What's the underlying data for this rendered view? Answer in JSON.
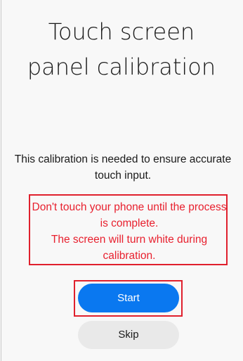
{
  "title": {
    "line1": "Touch screen",
    "line2": "panel calibration"
  },
  "info_text": "This calibration is needed to ensure accurate touch input.",
  "warning": {
    "line1": "Don't touch your phone until the process is complete.",
    "line2": "The screen will turn white during calibration."
  },
  "buttons": {
    "start_label": "Start",
    "skip_label": "Skip"
  },
  "colors": {
    "accent": "#0a78f0",
    "warning": "#e8202e",
    "highlight": "#e0202d",
    "background": "#f8f8f8"
  }
}
